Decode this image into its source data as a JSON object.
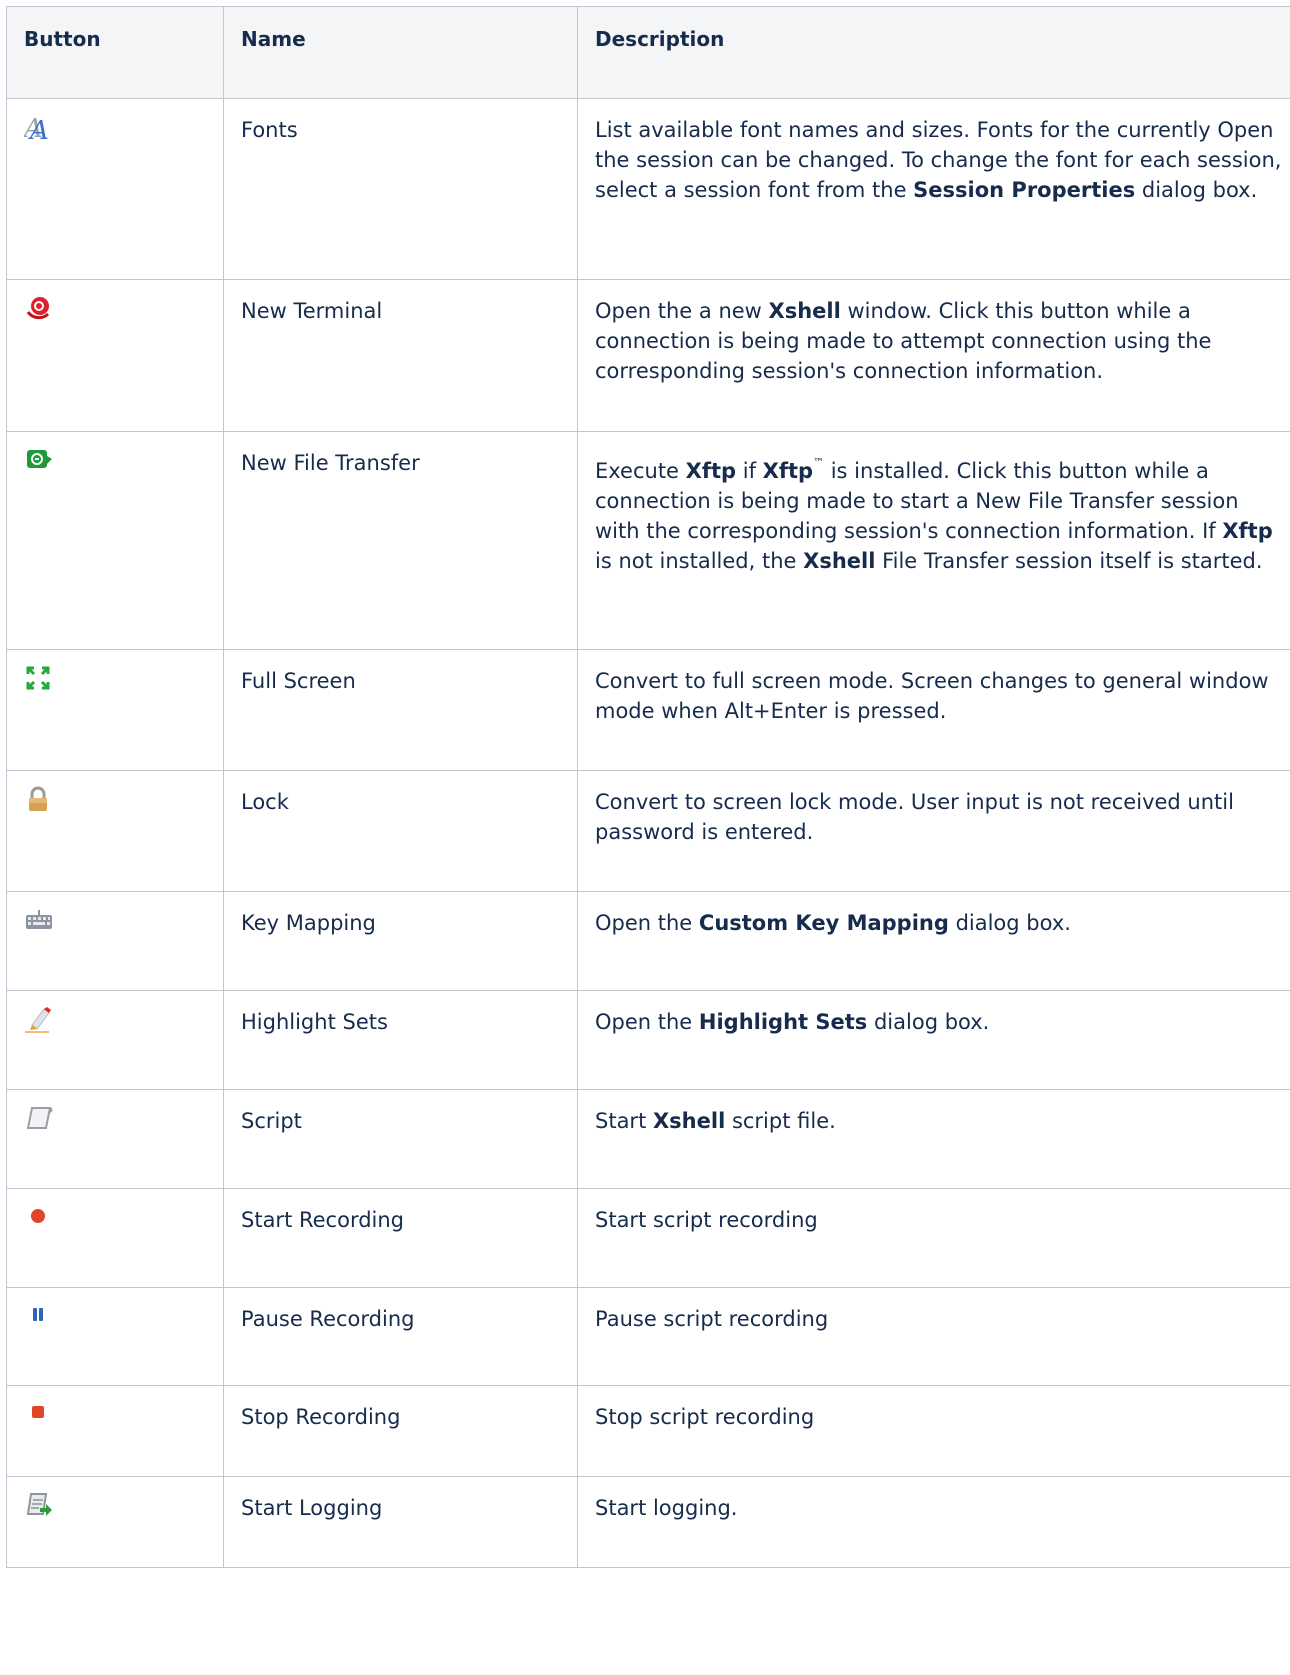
{
  "headers": {
    "button": "Button",
    "name": "Name",
    "description": "Description"
  },
  "rows": [
    {
      "icon": "fonts-icon",
      "name": "Fonts",
      "desc": [
        [
          "List available font names and sizes. Fonts for the currently Open the session can be changed. To change the font for each session, select a session font from the ",
          false
        ],
        [
          "Session Properties",
          true
        ],
        [
          " dialog box.",
          false
        ]
      ]
    },
    {
      "icon": "new-terminal-icon",
      "name": "New Terminal",
      "desc": [
        [
          "Open the a new ",
          false
        ],
        [
          "Xshell",
          true
        ],
        [
          " window. Click this button while a connection is being made to attempt connection using the corresponding session's connection information.",
          false
        ]
      ]
    },
    {
      "icon": "new-file-transfer-icon",
      "name": "New File Transfer",
      "desc": [
        [
          "Execute ",
          false
        ],
        [
          "Xftp",
          true
        ],
        [
          " if ",
          false
        ],
        [
          "Xftp",
          true
        ],
        [
          "™",
          "sup"
        ],
        [
          " is installed. Click this button while a connection is being made to start a New File Transfer session with the corresponding session's connection information. If ",
          false
        ],
        [
          "Xftp",
          true
        ],
        [
          " is not installed, the ",
          false
        ],
        [
          "Xshell",
          true
        ],
        [
          " File Transfer session itself is started.",
          false
        ]
      ]
    },
    {
      "icon": "full-screen-icon",
      "name": "Full Screen",
      "desc": [
        [
          "Convert to full screen mode. Screen changes to general window mode when Alt+Enter is pressed.",
          false
        ]
      ]
    },
    {
      "icon": "lock-icon",
      "name": "Lock",
      "desc": [
        [
          "Convert to screen lock mode. User input is not received until password is entered.",
          false
        ]
      ]
    },
    {
      "icon": "keyboard-icon",
      "name": "Key Mapping",
      "desc": [
        [
          "Open the ",
          false
        ],
        [
          "Custom Key Mapping",
          true
        ],
        [
          " dialog box.",
          false
        ]
      ]
    },
    {
      "icon": "highlighter-icon",
      "name": "Highlight Sets",
      "desc": [
        [
          "Open the ",
          false
        ],
        [
          "Highlight Sets",
          true
        ],
        [
          " dialog box.",
          false
        ]
      ]
    },
    {
      "icon": "script-icon",
      "name": "Script",
      "desc": [
        [
          "Start ",
          false
        ],
        [
          "Xshell",
          true
        ],
        [
          " script file.",
          false
        ]
      ]
    },
    {
      "icon": "record-icon",
      "name": "Start Recording",
      "desc": [
        [
          "Start script recording",
          false
        ]
      ]
    },
    {
      "icon": "pause-icon",
      "name": "Pause Recording",
      "desc": [
        [
          "Pause script recording",
          false
        ]
      ]
    },
    {
      "icon": "stop-icon",
      "name": "Stop Recording",
      "desc": [
        [
          "Stop script recording",
          false
        ]
      ]
    },
    {
      "icon": "start-logging-icon",
      "name": "Start Logging",
      "desc": [
        [
          "Start logging.",
          false
        ]
      ]
    }
  ]
}
